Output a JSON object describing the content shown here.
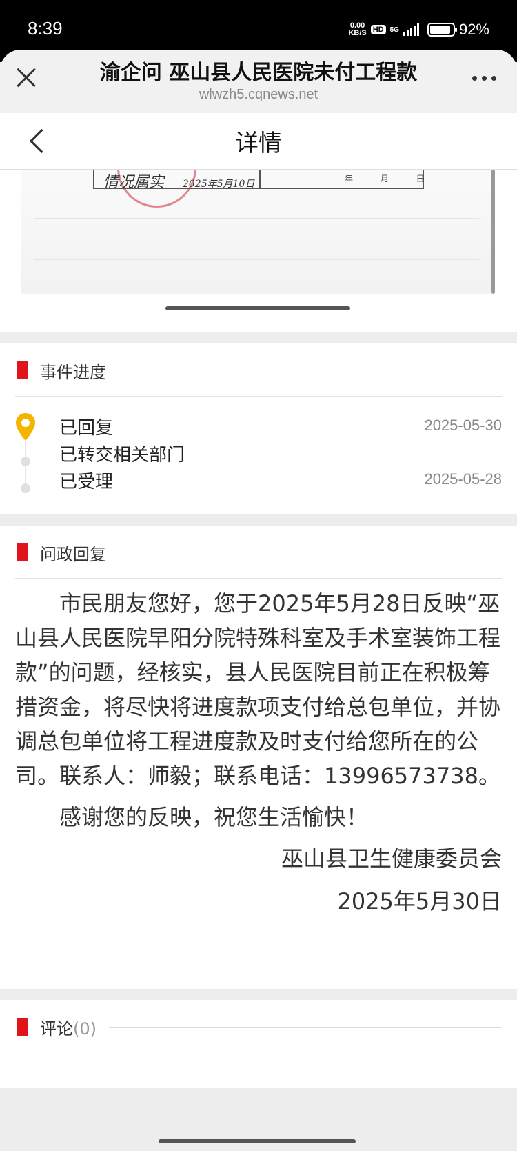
{
  "status_bar": {
    "time": "8:39",
    "net_speed_value": "0.00",
    "net_speed_unit": "KB/S",
    "hd_label": "HD",
    "network_label": "5G",
    "battery_percent": "92%",
    "battery_level": 0.92,
    "icons": [
      "hd-badge-icon",
      "signal-5g-icon",
      "battery-icon"
    ]
  },
  "browser_bar": {
    "title": "渝企问 巫山县人民医院未付工程款",
    "url": "wlwzh5.cqnews.net",
    "icons": [
      "close-icon",
      "more-icon"
    ]
  },
  "nav": {
    "title": "详情",
    "icons": [
      "back-chevron-icon"
    ]
  },
  "document_image": {
    "date_fragment": "年  月  日",
    "handwriting": "情况属实",
    "handwritten_date": "2025年5月10日"
  },
  "progress": {
    "section_title": "事件进度",
    "steps": [
      {
        "label": "已回复",
        "date": "2025-05-30",
        "current": true
      },
      {
        "label": "已转交相关部门",
        "date": ""
      },
      {
        "label": "已受理",
        "date": "2025-05-28"
      }
    ],
    "icons": [
      "location-pin-icon"
    ]
  },
  "reply": {
    "section_title": "问政回复",
    "paragraph": "市民朋友您好，您于2025年5月28日反映“巫山县人民医院早阳分院特殊科室及手术室装饰工程款”的问题，经核实，县人民医院目前正在积极筹措资金，将尽快将进度款项支付给总包单位，并协调总包单位将工程进度款及时支付给您所在的公司。联系人：师毅；联系电话：13996573738。",
    "thanks": "感谢您的反映，祝您生活愉快！",
    "signature": "巫山县卫生健康委员会",
    "date": "2025年5月30日"
  },
  "comments": {
    "section_title": "评论",
    "count": "(0)"
  },
  "colors": {
    "accent_red": "#e0141b",
    "pin_yellow": "#f4b400",
    "background_gray": "#ededed"
  }
}
